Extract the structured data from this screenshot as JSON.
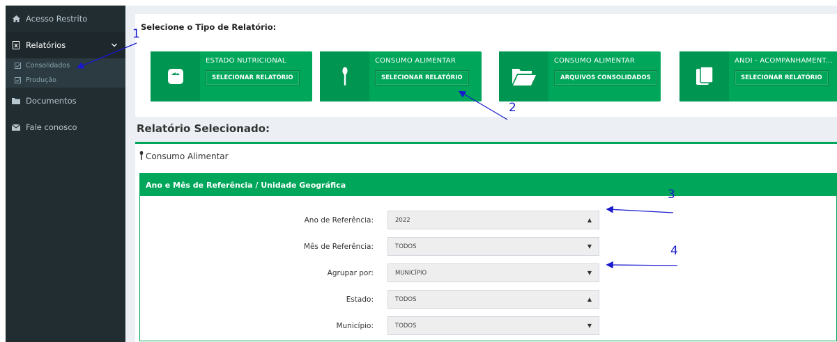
{
  "sidebar": {
    "items": [
      {
        "label": "Acesso Restrito",
        "icon": "home-icon"
      },
      {
        "label": "Relatórios",
        "icon": "report-icon"
      },
      {
        "label": "Documentos",
        "icon": "folder-icon"
      },
      {
        "label": "Fale conosco",
        "icon": "envelope-icon"
      }
    ],
    "subitems": [
      {
        "label": "Consolidados",
        "icon": "check-square-icon"
      },
      {
        "label": "Produção",
        "icon": "check-square-icon"
      }
    ]
  },
  "report_type": {
    "title": "Selecione o Tipo de Relatório:",
    "tiles": [
      {
        "label": "ESTADO NUTRICIONAL",
        "button": "SELECIONAR RELATÓRIO",
        "icon": "scale-icon"
      },
      {
        "label": "CONSUMO ALIMENTAR",
        "button": "SELECIONAR RELATÓRIO",
        "icon": "spoon-icon"
      },
      {
        "label": "CONSUMO ALIMENTAR",
        "button": "ARQUIVOS CONSOLIDADOS",
        "icon": "folder-open-icon"
      },
      {
        "label": "ANDI - ACOMPANHAMENT...",
        "button": "SELECIONAR RELATÓRIO",
        "icon": "book-icon"
      }
    ]
  },
  "selected": {
    "title": "Relatório Selecionado:",
    "name": "Consumo Alimentar",
    "panel_title": "Ano e Mês de Referência / Unidade Geográfica",
    "fields": [
      {
        "label": "Ano de Referência:",
        "value": "2022",
        "caret": "▲"
      },
      {
        "label": "Mês de Referência:",
        "value": "TODOS",
        "caret": "▼"
      },
      {
        "label": "Agrupar por:",
        "value": "MUNICÍPIO",
        "caret": "▼"
      },
      {
        "label": "Estado:",
        "value": "TODOS",
        "caret": "▲"
      },
      {
        "label": "Município:",
        "value": "TODOS",
        "caret": "▼"
      }
    ]
  },
  "annotations": [
    "1",
    "2",
    "3",
    "4"
  ],
  "colors": {
    "sidebar": "#222d32",
    "green": "#00a65a",
    "annotation": "#1a1acd"
  }
}
